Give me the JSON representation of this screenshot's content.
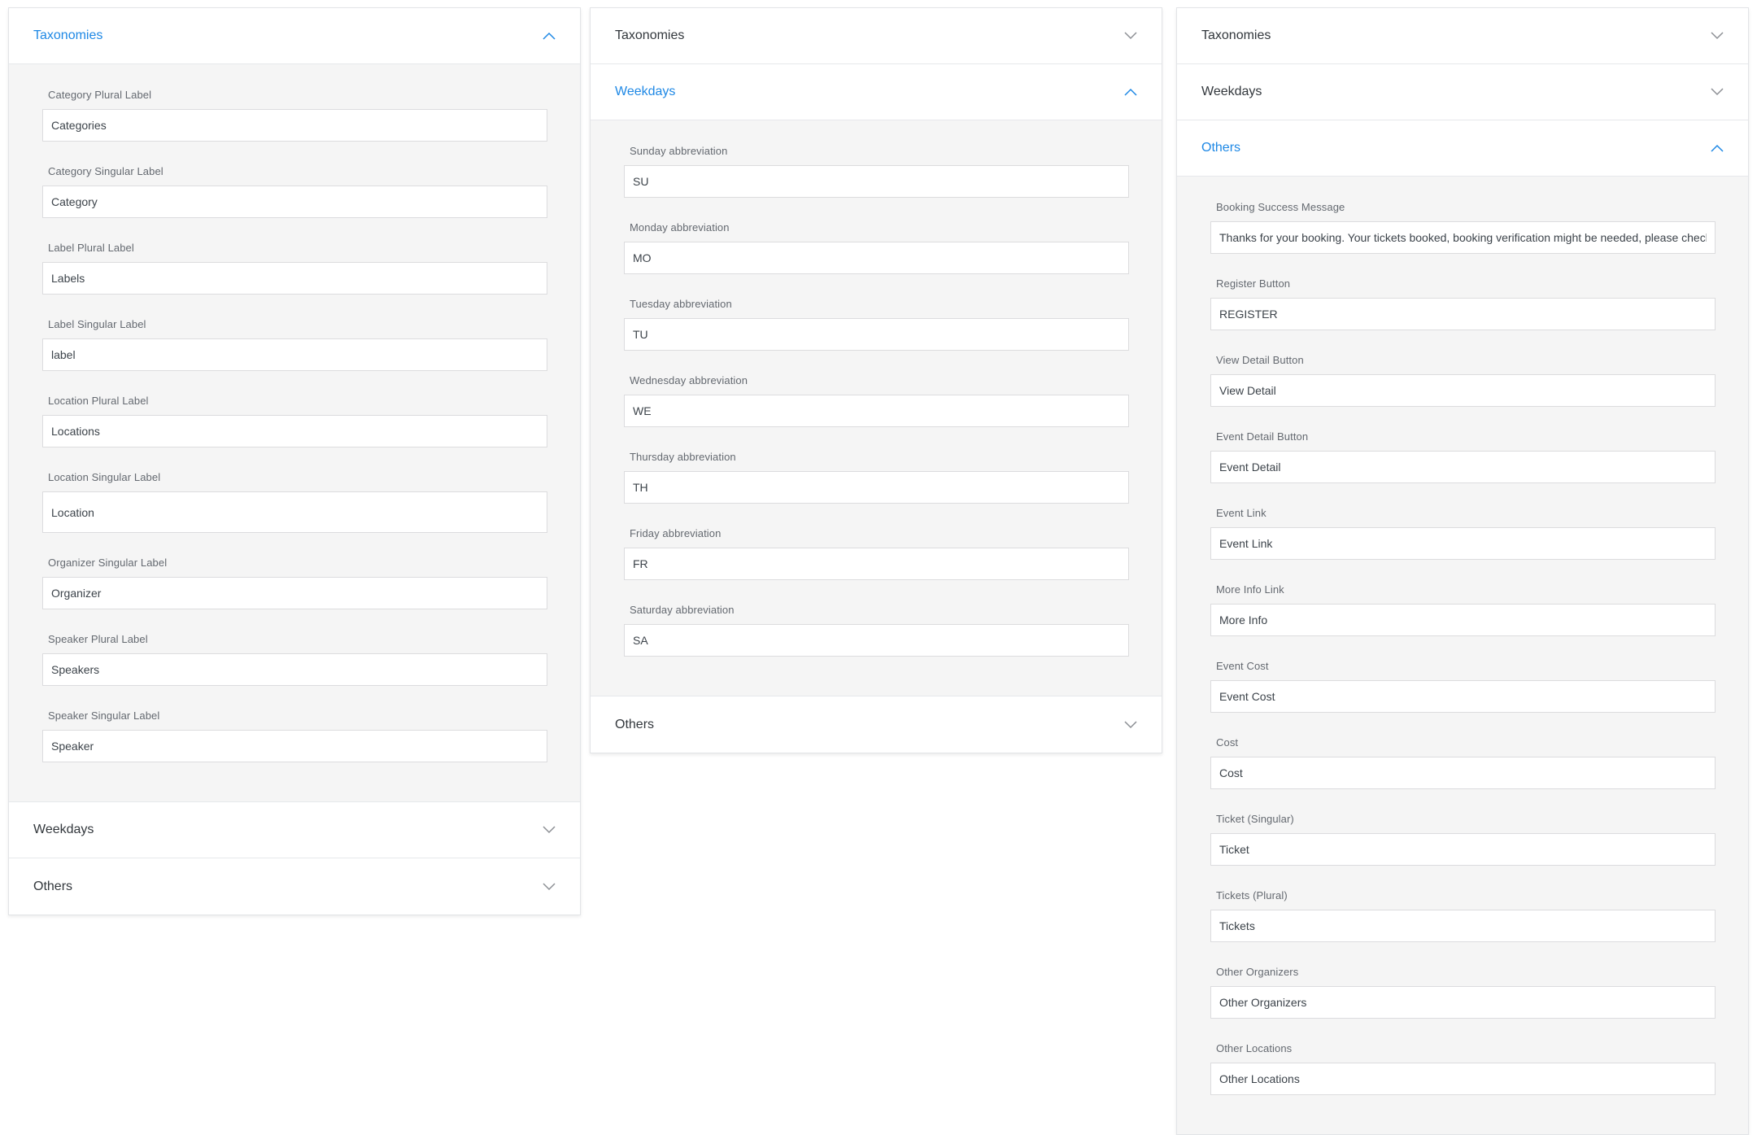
{
  "accent_color": "#1e88e5",
  "panels": [
    {
      "headers": {
        "taxonomies": "Taxonomies",
        "weekdays": "Weekdays",
        "others": "Others"
      },
      "fields": [
        {
          "label": "Category Plural Label",
          "value": "Categories"
        },
        {
          "label": "Category Singular Label",
          "value": "Category"
        },
        {
          "label": "Label Plural Label",
          "value": "Labels"
        },
        {
          "label": "Label Singular Label",
          "value": "label"
        },
        {
          "label": "Location Plural Label",
          "value": "Locations"
        },
        {
          "label": "Location Singular Label",
          "value": "Location"
        },
        {
          "label": "Organizer Singular Label",
          "value": "Organizer"
        },
        {
          "label": "Speaker Plural Label",
          "value": "Speakers"
        },
        {
          "label": "Speaker Singular Label",
          "value": "Speaker"
        }
      ]
    },
    {
      "headers": {
        "taxonomies": "Taxonomies",
        "weekdays": "Weekdays",
        "others": "Others"
      },
      "fields": [
        {
          "label": "Sunday abbreviation",
          "value": "SU"
        },
        {
          "label": "Monday abbreviation",
          "value": "MO"
        },
        {
          "label": "Tuesday abbreviation",
          "value": "TU"
        },
        {
          "label": "Wednesday abbreviation",
          "value": "WE"
        },
        {
          "label": "Thursday abbreviation",
          "value": "TH"
        },
        {
          "label": "Friday abbreviation",
          "value": "FR"
        },
        {
          "label": "Saturday abbreviation",
          "value": "SA"
        }
      ]
    },
    {
      "headers": {
        "taxonomies": "Taxonomies",
        "weekdays": "Weekdays",
        "others": "Others"
      },
      "fields": [
        {
          "label": "Booking Success Message",
          "value": "Thanks for your booking. Your tickets booked, booking verification might be needed, please check your email."
        },
        {
          "label": "Register Button",
          "value": "REGISTER"
        },
        {
          "label": "View Detail Button",
          "value": "View Detail"
        },
        {
          "label": "Event Detail Button",
          "value": "Event Detail"
        },
        {
          "label": "Event Link",
          "value": "Event Link"
        },
        {
          "label": "More Info Link",
          "value": "More Info"
        },
        {
          "label": "Event Cost",
          "value": "Event Cost"
        },
        {
          "label": "Cost",
          "value": "Cost"
        },
        {
          "label": "Ticket (Singular)",
          "value": "Ticket"
        },
        {
          "label": "Tickets (Plural)",
          "value": "Tickets"
        },
        {
          "label": "Other Organizers",
          "value": "Other Organizers"
        },
        {
          "label": "Other Locations",
          "value": "Other Locations"
        }
      ]
    }
  ]
}
